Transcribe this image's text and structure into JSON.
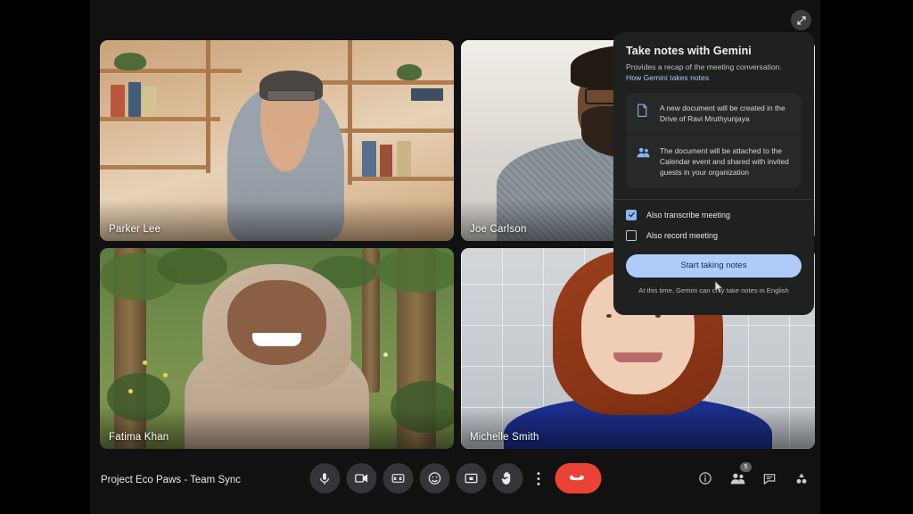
{
  "window": {
    "expand_icon": "expand-diagonal-icon"
  },
  "meeting": {
    "title": "Project Eco Paws - Team Sync",
    "participants": [
      {
        "name": "Parker Lee",
        "speaking": false
      },
      {
        "name": "Joe Carlson",
        "speaking": true
      },
      {
        "name": "Fatima Khan",
        "speaking": false
      },
      {
        "name": "Michelle Smith",
        "speaking": false
      }
    ]
  },
  "gemini_panel": {
    "title": "Take notes with Gemini",
    "subtitle": "Provides a recap of the meeting conversation.",
    "link": "How Gemini takes notes",
    "info_rows": [
      {
        "icon": "document-icon",
        "text": "A new document will be created in the Drive of Ravi Mruthyunjaya"
      },
      {
        "icon": "people-group-icon",
        "text": "The document will be attached to the Calendar event and shared with invited guests in your organization"
      }
    ],
    "checkboxes": [
      {
        "label": "Also transcribe meeting",
        "checked": true
      },
      {
        "label": "Also record meeting",
        "checked": false
      }
    ],
    "cta_label": "Start taking notes",
    "footnote": "At this time, Gemini can only take notes in English",
    "accent_color": "#aecbfa",
    "link_color": "#a8c7fa",
    "background_color": "#1f2020"
  },
  "controls": [
    {
      "name": "microphone-button",
      "icon": "microphone-icon"
    },
    {
      "name": "camera-button",
      "icon": "video-camera-icon"
    },
    {
      "name": "captions-button",
      "icon": "closed-captions-icon"
    },
    {
      "name": "reactions-button",
      "icon": "emoji-smiley-icon"
    },
    {
      "name": "present-button",
      "icon": "present-screen-icon"
    },
    {
      "name": "raise-hand-button",
      "icon": "raised-hand-icon"
    },
    {
      "name": "more-options-button",
      "icon": "vertical-dots-icon"
    },
    {
      "name": "end-call-button",
      "icon": "phone-hangup-icon"
    }
  ],
  "right_controls": [
    {
      "name": "meeting-details-button",
      "icon": "info-circle-icon",
      "badge": ""
    },
    {
      "name": "people-button",
      "icon": "people-icon",
      "badge": "5"
    },
    {
      "name": "chat-button",
      "icon": "chat-bubble-icon",
      "badge": ""
    },
    {
      "name": "activities-button",
      "icon": "activities-shapes-icon",
      "badge": ""
    }
  ],
  "colors": {
    "end_call": "#ea4335",
    "control_bg": "#333538",
    "speaking_border": "#8ab4f8"
  }
}
